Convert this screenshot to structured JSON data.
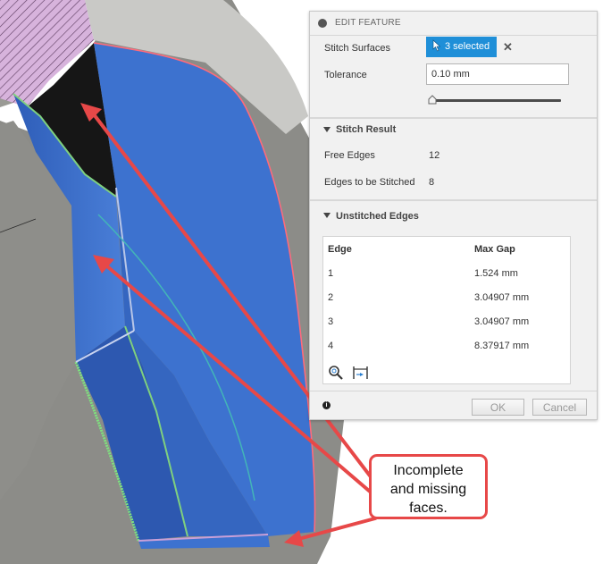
{
  "panel": {
    "title": "EDIT FEATURE",
    "stitch_surfaces_label": "Stitch Surfaces",
    "selection_label": "3 selected",
    "clear_selection_symbol": "✕",
    "tolerance_label": "Tolerance",
    "tolerance_value": "0.10 mm",
    "stitch_result": {
      "header": "Stitch Result",
      "free_edges_label": "Free Edges",
      "free_edges_value": "12",
      "edges_to_stitch_label": "Edges to be Stitched",
      "edges_to_stitch_value": "8"
    },
    "unstitched": {
      "header": "Unstitched Edges",
      "columns": [
        "Edge",
        "Max Gap"
      ],
      "rows": [
        {
          "edge": "1",
          "gap": "1.524 mm"
        },
        {
          "edge": "2",
          "gap": "3.04907 mm"
        },
        {
          "edge": "3",
          "gap": "3.04907 mm"
        },
        {
          "edge": "4",
          "gap": "8.37917 mm"
        }
      ]
    },
    "ok_label": "OK",
    "cancel_label": "Cancel",
    "info_symbol": "i"
  },
  "callout": {
    "lines": [
      "Incomplete",
      "and missing",
      "faces."
    ]
  },
  "colors": {
    "accent": "#1f8fd8",
    "annotation_red": "#e74848",
    "surface_blue": "#3b6fc9",
    "model_gray": "#8a8a85"
  }
}
